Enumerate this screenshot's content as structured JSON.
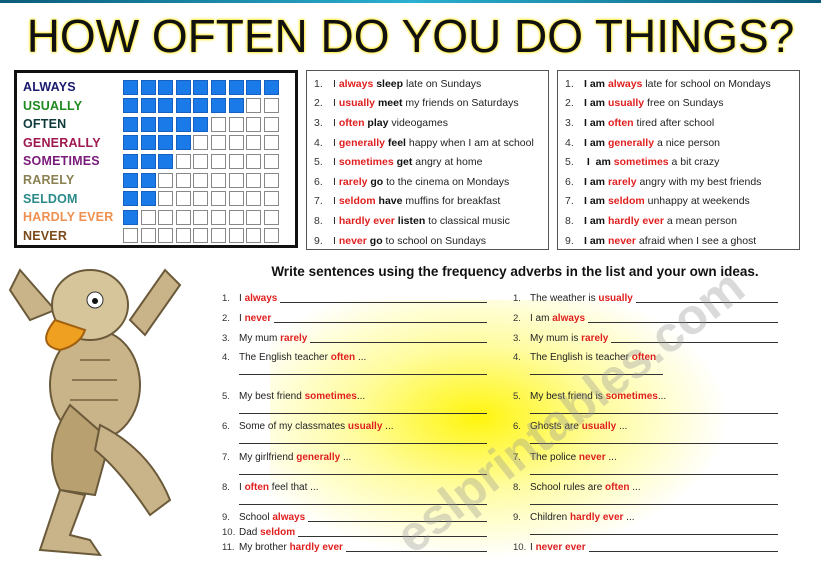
{
  "title": "HOW OFTEN DO YOU DO THINGS?",
  "watermark": "eslprintables.com",
  "colors": {
    "box_fill": "#1a7ae8",
    "adverb_red": "#e01f1f",
    "glow": "#fff500"
  },
  "frequency_chart": {
    "total_boxes": 9,
    "rows": [
      {
        "label": "ALWAYS",
        "filled": 9,
        "color": "#1a1a6e"
      },
      {
        "label": "USUALLY",
        "filled": 7,
        "color": "#1e8a1e"
      },
      {
        "label": "OFTEN",
        "filled": 5,
        "color": "#0f3a3a"
      },
      {
        "label": "GENERALLY",
        "filled": 4,
        "color": "#a01850"
      },
      {
        "label": "SOMETIMES",
        "filled": 3,
        "color": "#7a1a7a"
      },
      {
        "label": "RARELY",
        "filled": 2,
        "color": "#8a8050"
      },
      {
        "label": "SELDOM",
        "filled": 2,
        "color": "#2a8a8a"
      },
      {
        "label": "HARDLY EVER",
        "filled": 1,
        "color": "#f09050"
      },
      {
        "label": "NEVER",
        "filled": 0,
        "color": "#7a4a1a"
      }
    ]
  },
  "examples_verbs": [
    {
      "n": "1.",
      "parts": [
        {
          "t": "I ",
          "s": ""
        },
        {
          "t": "always",
          "s": "r"
        },
        {
          "t": " sleep",
          "s": "b"
        },
        {
          "t": " late on Sundays",
          "s": ""
        }
      ]
    },
    {
      "n": "2.",
      "parts": [
        {
          "t": "I ",
          "s": ""
        },
        {
          "t": "usually",
          "s": "r"
        },
        {
          "t": " meet",
          "s": "b"
        },
        {
          "t": " my friends on Saturdays",
          "s": ""
        }
      ]
    },
    {
      "n": "3.",
      "parts": [
        {
          "t": "I ",
          "s": ""
        },
        {
          "t": "often",
          "s": "r"
        },
        {
          "t": " play",
          "s": "b"
        },
        {
          "t": " videogames",
          "s": ""
        }
      ]
    },
    {
      "n": "4.",
      "parts": [
        {
          "t": "I ",
          "s": ""
        },
        {
          "t": "generally",
          "s": "r"
        },
        {
          "t": " feel",
          "s": "b"
        },
        {
          "t": " happy when I am at school",
          "s": ""
        }
      ]
    },
    {
      "n": "5.",
      "parts": [
        {
          "t": "I ",
          "s": ""
        },
        {
          "t": "sometimes",
          "s": "r"
        },
        {
          "t": " get",
          "s": "b"
        },
        {
          "t": " angry at home",
          "s": ""
        }
      ]
    },
    {
      "n": "6.",
      "parts": [
        {
          "t": "I ",
          "s": ""
        },
        {
          "t": "rarely",
          "s": "r"
        },
        {
          "t": " go",
          "s": "b"
        },
        {
          "t": " to the cinema on Mondays",
          "s": ""
        }
      ]
    },
    {
      "n": "7.",
      "parts": [
        {
          "t": "I ",
          "s": ""
        },
        {
          "t": "seldom",
          "s": "r"
        },
        {
          "t": " have",
          "s": "b"
        },
        {
          "t": " muffins for breakfast",
          "s": ""
        }
      ]
    },
    {
      "n": "8.",
      "parts": [
        {
          "t": "I ",
          "s": ""
        },
        {
          "t": "hardly ever",
          "s": "r"
        },
        {
          "t": " listen",
          "s": "b"
        },
        {
          "t": " to classical music",
          "s": ""
        }
      ]
    },
    {
      "n": "9.",
      "parts": [
        {
          "t": "I ",
          "s": ""
        },
        {
          "t": "never",
          "s": "r"
        },
        {
          "t": " go",
          "s": "b"
        },
        {
          "t": " to school on Sundays",
          "s": ""
        }
      ]
    }
  ],
  "examples_be": [
    {
      "n": "1.",
      "parts": [
        {
          "t": "I am ",
          "s": "b"
        },
        {
          "t": "always",
          "s": "r"
        },
        {
          "t": " late for school on Mondays",
          "s": ""
        }
      ]
    },
    {
      "n": "2.",
      "parts": [
        {
          "t": "I am ",
          "s": "b"
        },
        {
          "t": "usually",
          "s": "r"
        },
        {
          "t": " free on Sundays",
          "s": ""
        }
      ]
    },
    {
      "n": "3.",
      "parts": [
        {
          "t": "I am ",
          "s": "b"
        },
        {
          "t": "often",
          "s": "r"
        },
        {
          "t": " tired after school",
          "s": ""
        }
      ]
    },
    {
      "n": "4.",
      "parts": [
        {
          "t": "I am ",
          "s": "b"
        },
        {
          "t": "generally",
          "s": "r"
        },
        {
          "t": " a nice person",
          "s": ""
        }
      ]
    },
    {
      "n": "5.",
      "parts": [
        {
          "t": " I  am ",
          "s": "b"
        },
        {
          "t": "sometimes",
          "s": "r"
        },
        {
          "t": " a bit crazy",
          "s": ""
        }
      ]
    },
    {
      "n": "6.",
      "parts": [
        {
          "t": "I am ",
          "s": "b"
        },
        {
          "t": "rarely",
          "s": "r"
        },
        {
          "t": " angry with my best friends",
          "s": ""
        }
      ]
    },
    {
      "n": "7.",
      "parts": [
        {
          "t": "I am ",
          "s": "b"
        },
        {
          "t": "seldom",
          "s": "r"
        },
        {
          "t": " unhappy at weekends",
          "s": ""
        }
      ]
    },
    {
      "n": "8.",
      "parts": [
        {
          "t": "I am ",
          "s": "b"
        },
        {
          "t": "hardly ever",
          "s": "r"
        },
        {
          "t": " a mean person",
          "s": ""
        }
      ]
    },
    {
      "n": "9.",
      "parts": [
        {
          "t": "I am ",
          "s": "b"
        },
        {
          "t": "never",
          "s": "r"
        },
        {
          "t": " afraid when I see a ghost",
          "s": ""
        }
      ]
    }
  ],
  "exercise_heading": "Write sentences using the frequency adverbs in the list and your own ideas.",
  "exercise_left": [
    {
      "n": "1.",
      "parts": [
        {
          "t": "I ",
          "s": ""
        },
        {
          "t": "always",
          "s": "r"
        }
      ],
      "blank": "inline"
    },
    {
      "n": "2.",
      "parts": [
        {
          "t": "I ",
          "s": ""
        },
        {
          "t": "never",
          "s": "r"
        }
      ],
      "blank": "inline"
    },
    {
      "n": "3.",
      "parts": [
        {
          "t": "My mum ",
          "s": ""
        },
        {
          "t": "rarely",
          "s": "r"
        }
      ],
      "blank": "inline"
    },
    {
      "n": "4.",
      "parts": [
        {
          "t": "The English teacher ",
          "s": ""
        },
        {
          "t": "often",
          "s": "r"
        },
        {
          "t": " ...",
          "s": ""
        }
      ],
      "blank": "below"
    },
    {
      "n": "5.",
      "parts": [
        {
          "t": "My best friend ",
          "s": ""
        },
        {
          "t": "sometimes",
          "s": "r"
        },
        {
          "t": "...",
          "s": ""
        }
      ],
      "blank": "below"
    },
    {
      "n": "6.",
      "parts": [
        {
          "t": "Some of my classmates ",
          "s": ""
        },
        {
          "t": "usually",
          "s": "r"
        },
        {
          "t": " ...",
          "s": ""
        }
      ],
      "blank": "below"
    },
    {
      "n": "7.",
      "parts": [
        {
          "t": "My girlfriend ",
          "s": ""
        },
        {
          "t": "generally",
          "s": "r"
        },
        {
          "t": " ...",
          "s": ""
        }
      ],
      "blank": "below"
    },
    {
      "n": "8.",
      "parts": [
        {
          "t": "I ",
          "s": ""
        },
        {
          "t": "often",
          "s": "r"
        },
        {
          "t": " feel that ...",
          "s": ""
        }
      ],
      "blank": "below"
    },
    {
      "n": "9.",
      "parts": [
        {
          "t": "School ",
          "s": ""
        },
        {
          "t": "always",
          "s": "r"
        }
      ],
      "blank": "inline"
    },
    {
      "n": "10.",
      "parts": [
        {
          "t": "Dad ",
          "s": ""
        },
        {
          "t": "seldom",
          "s": "r"
        }
      ],
      "blank": "inline"
    },
    {
      "n": "11.",
      "parts": [
        {
          "t": "My brother ",
          "s": ""
        },
        {
          "t": "hardly ever",
          "s": "r"
        }
      ],
      "blank": "inline"
    }
  ],
  "exercise_right": [
    {
      "n": "1.",
      "parts": [
        {
          "t": "The weather is ",
          "s": ""
        },
        {
          "t": "usually",
          "s": "r"
        }
      ],
      "blank": "inline"
    },
    {
      "n": "2.",
      "parts": [
        {
          "t": "I am ",
          "s": ""
        },
        {
          "t": "always",
          "s": "r"
        }
      ],
      "blank": "inline"
    },
    {
      "n": "3.",
      "parts": [
        {
          "t": "My mum is ",
          "s": ""
        },
        {
          "t": "rarely",
          "s": "r"
        }
      ],
      "blank": "inline"
    },
    {
      "n": "4.",
      "parts": [
        {
          "t": "The English is teacher ",
          "s": ""
        },
        {
          "t": "often",
          "s": "r"
        }
      ],
      "blank": "short-below"
    },
    {
      "n": "5.",
      "parts": [
        {
          "t": "My best friend is ",
          "s": ""
        },
        {
          "t": "sometimes",
          "s": "r"
        },
        {
          "t": "...",
          "s": ""
        }
      ],
      "blank": "below"
    },
    {
      "n": "6.",
      "parts": [
        {
          "t": "Ghosts are ",
          "s": ""
        },
        {
          "t": "usually",
          "s": "r"
        },
        {
          "t": " ...",
          "s": ""
        }
      ],
      "blank": "below"
    },
    {
      "n": "7.",
      "parts": [
        {
          "t": "The police ",
          "s": ""
        },
        {
          "t": "never",
          "s": "r"
        },
        {
          "t": " ...",
          "s": ""
        }
      ],
      "blank": "below"
    },
    {
      "n": "8.",
      "parts": [
        {
          "t": "School rules are ",
          "s": ""
        },
        {
          "t": "often",
          "s": "r"
        },
        {
          "t": " ...",
          "s": ""
        }
      ],
      "blank": "below"
    },
    {
      "n": "9.",
      "parts": [
        {
          "t": "Children ",
          "s": ""
        },
        {
          "t": "hardly ever",
          "s": "r"
        },
        {
          "t": " ...",
          "s": ""
        }
      ],
      "blank": "below"
    },
    {
      "n": "10.",
      "parts": [
        {
          "t": "I ",
          "s": ""
        },
        {
          "t": "never ever",
          "s": "r"
        }
      ],
      "blank": "inline"
    }
  ]
}
